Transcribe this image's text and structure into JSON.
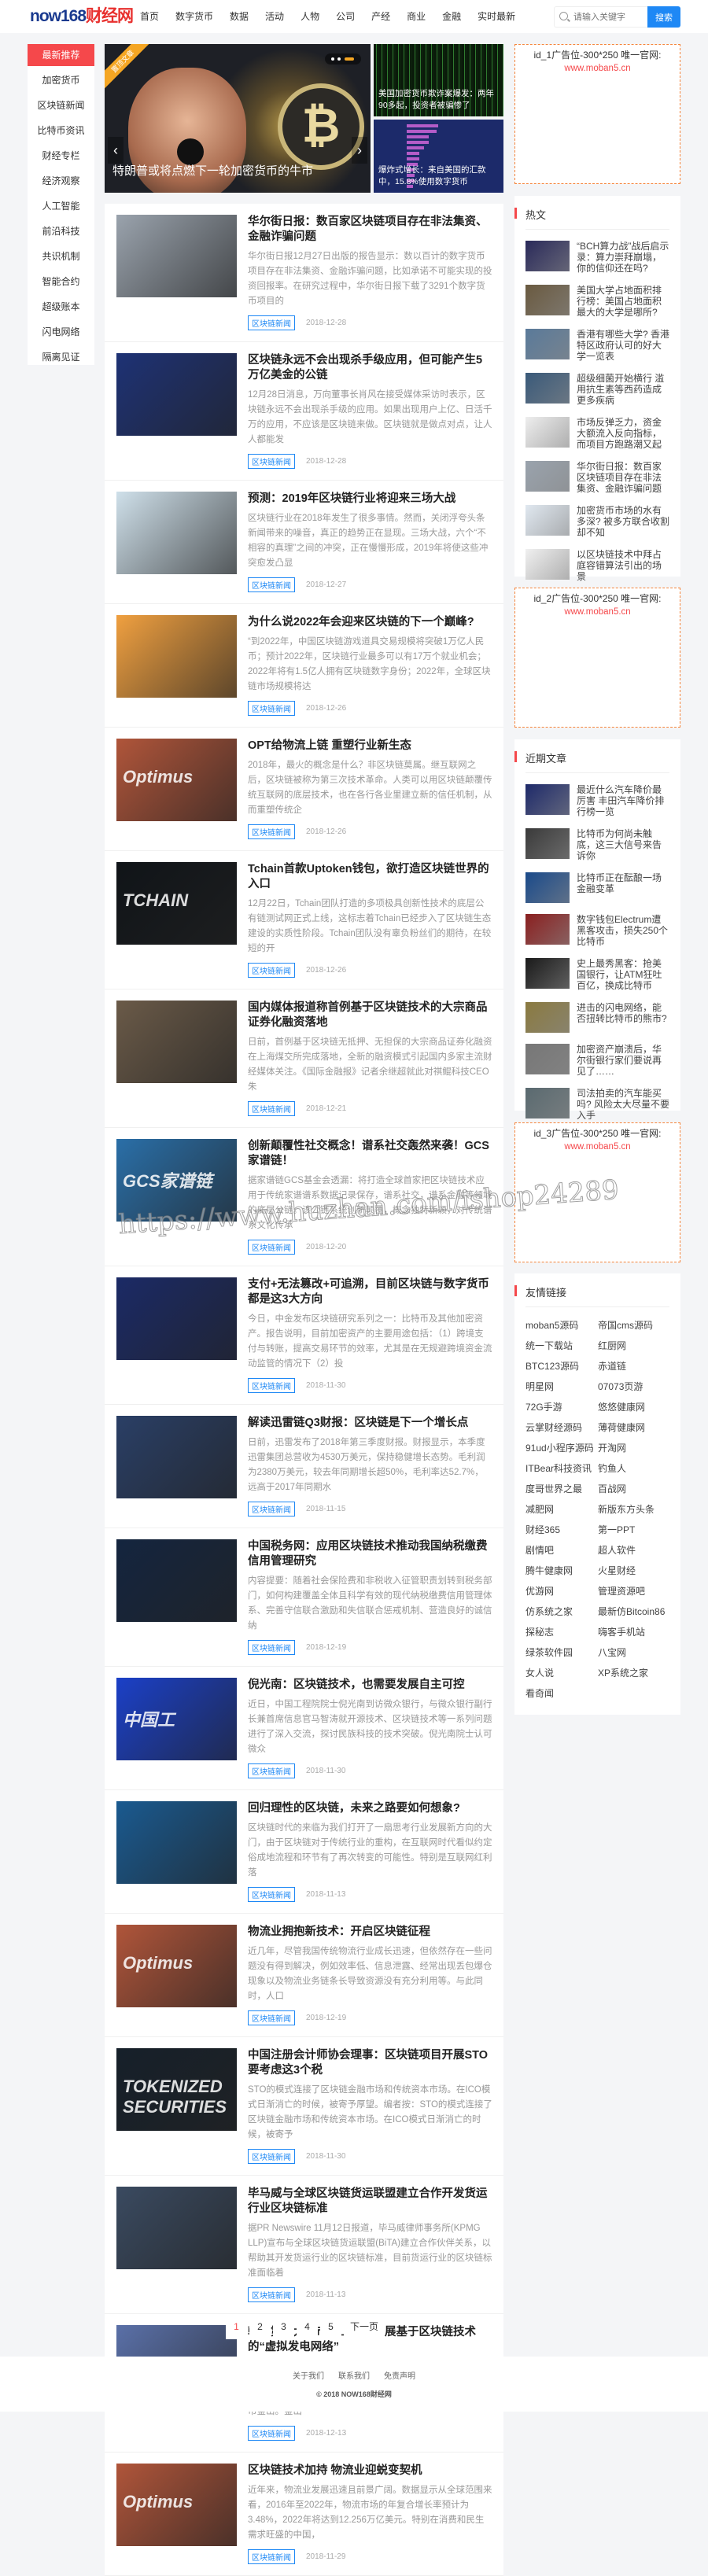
{
  "header": {
    "logo_a": "now168",
    "logo_b": "财经网",
    "nav": [
      "首页",
      "数字货币",
      "数据",
      "活动",
      "人物",
      "公司",
      "产经",
      "商业",
      "金融",
      "实时最新"
    ],
    "search_placeholder": "请输入关键字",
    "search_button": "搜索"
  },
  "leftnav": [
    "最新推荐",
    "加密货币",
    "区块链新闻",
    "比特币资讯",
    "财经专栏",
    "经济观察",
    "人工智能",
    "前沿科技",
    "共识机制",
    "智能合约",
    "超级账本",
    "闪电网络",
    "隔离见证"
  ],
  "slider": {
    "ribbon": "置顶文章",
    "caption": "特朗普或将点燃下一轮加密货币的牛市",
    "prev": "‹",
    "next": "›",
    "coin": "₿",
    "side": [
      "美国加密货币欺诈案爆发：两年90多起，投资者被骗惨了",
      "爆炸式增长：来自美国的汇款中，15.8%使用数字货币"
    ]
  },
  "ads": [
    {
      "title": "id_1广告位-300*250 唯一官网:",
      "url": "www.moban5.cn"
    },
    {
      "title": "id_2广告位-300*250 唯一官网:",
      "url": "www.moban5.cn"
    },
    {
      "title": "id_3广告位-300*250 唯一官网:",
      "url": "www.moban5.cn"
    }
  ],
  "articles": [
    {
      "title": "华尔街日报：数百家区块链项目存在非法集资、金融诈骗问题",
      "excerpt": "华尔街日报12月27日出版的报告显示：数以百计的数字货币项目存在非法集资、金融诈骗问题，比如承诺不可能实现的投资回报率。在研究过程中，华尔街日报下载了3291个数字货币项目的",
      "tag": "区块链新闻",
      "date": "2018-12-28",
      "color": "#9aa3ad"
    },
    {
      "title": "区块链永远不会出现杀手级应用，但可能产生5万亿美金的公链",
      "excerpt": "12月28日消息，万向董事长肖风在接受媒体采访时表示，区块链永远不会出现杀手级的应用。如果出现用户上亿、日活千万的应用，不应该是区块链来做。区块链就是做点对点，让人人都能发",
      "tag": "区块链新闻",
      "date": "2018-12-28",
      "color": "#1e3275"
    },
    {
      "title": "预测：2019年区块链行业将迎来三场大战",
      "excerpt": "区块链行业在2018年发生了很多事情。然而，关闭浮夸头条新闻带来的噪音，真正的趋势正在显现。三场大战，六个“不相容的真理”之间的冲突，正在慢慢形成，2019年将使这些冲突愈发凸显",
      "tag": "区块链新闻",
      "date": "2018-12-27",
      "color": "#cfe0ea"
    },
    {
      "title": "为什么说2022年会迎来区块链的下一个巅峰?",
      "excerpt": "“到2022年，中国区块链游戏道具交易规模将突破1万亿人民币；预计2022年，区块链行业最多可以有17万个就业机会；2022年将有1.5亿人拥有区块链数字身份；2022年，全球区块链市场规模将达",
      "tag": "区块链新闻",
      "date": "2018-12-26",
      "color": "#f0a040"
    },
    {
      "title": "OPT给物流上链 重塑行业新生态",
      "excerpt": "2018年，最火的概念是什么？非区块链莫属。继互联网之后，区块链被称为第三次技术革命。人类可以用区块链颠覆传统互联网的底层技术，也在各行各业里建立新的信任机制，从而重塑传统企",
      "tag": "区块链新闻",
      "date": "2018-12-26",
      "color": "#b0553a",
      "overlay": "Optimus"
    },
    {
      "title": "Tchain首款Uptoken钱包，欲打造区块链世界的入口",
      "excerpt": "12月22日，Tchain团队打造的多项极具创新性技术的底层公有链测试网正式上线，这标志着Tchain已经步入了区块链生态建设的实质性阶段。Tchain团队没有辜负粉丝们的期待，在较短的开",
      "tag": "区块链新闻",
      "date": "2018-12-26",
      "color": "#101418",
      "overlay": "TCHAIN"
    },
    {
      "title": "国内媒体报道称首例基于区块链技术的大宗商品证券化融资落地",
      "excerpt": "日前，首例基于区块链无抵押、无担保的大宗商品证券化融资在上海煤交所完成落地，全新的融资模式引起国内多家主流财经媒体关注。《国际金融报》记者余继超就此对祺鲲科技CEO朱",
      "tag": "区块链新闻",
      "date": "2018-12-21",
      "color": "#6a5a48"
    },
    {
      "title": "创新颠覆性社交概念！谱系社交轰然来袭！GCS家谱链！",
      "excerpt": "据家谱链GCS基金会透漏：将打造全球首家把区块链技术应用于传统家谱谱系数据记录保存，谱系社交，谱系金融等领域的底层公链。该公链系统创新颠覆，概念独特新颖，对传统谱系文化传承",
      "tag": "区块链新闻",
      "date": "2018-12-20",
      "color": "#2a6fa8",
      "overlay": "GCS家谱链"
    },
    {
      "title": "支付+无法篡改+可追溯，目前区块链与数字货币都是这3大方向",
      "excerpt": "今日，中金发布区块链研究系列之一：比特币及其他加密资产。报告说明，目前加密资产的主要用途包括：（1）跨境支付与转账，提高交易环节的效率，尤其是在无规避跨境资金流动监管的情况下（2）投",
      "tag": "区块链新闻",
      "date": "2018-11-30",
      "color": "#1b2a66"
    },
    {
      "title": "解读迅雷链Q3财报：区块链是下一个增长点",
      "excerpt": "日前，迅雷发布了2018年第三季度财报。财报显示，本季度迅雷集团总营收为4530万美元，保持稳健增长态势。毛利润为2380万美元，较去年同期增长超50%，毛利率达52.7%，远高于2017年同期水",
      "tag": "区块链新闻",
      "date": "2018-11-15",
      "color": "#2a3f66"
    },
    {
      "title": "中国税务网：应用区块链技术推动我国纳税缴费信用管理研究",
      "excerpt": "内容提要：随着社会保险费和非税收入征管职责划转到税务部门，如何构建覆盖全体且科学有效的现代纳税缴费信用管理体系、完善守信联合激励和失信联合惩戒机制、营造良好的诚信纳",
      "tag": "区块链新闻",
      "date": "2018-12-19",
      "color": "#14253f"
    },
    {
      "title": "倪光南：区块链技术，也需要发展自主可控",
      "excerpt": "近日，中国工程院院士倪光南到访微众银行，与微众银行副行长兼首席信息官马智涛就开源技术、区块链技术等一系列问题进行了深入交流，探讨民族科技的技术突破。倪光南院士认可微众",
      "tag": "区块链新闻",
      "date": "2018-11-30",
      "color": "#1b40c8",
      "overlay": "中国工"
    },
    {
      "title": "回归理性的区块链，未来之路要如何想象?",
      "excerpt": "区块链时代的来临为我们打开了一扇思考行业发展新方向的大门，由于区块链对于传统行业的重构，在互联网时代看似约定俗成地流程和环节有了再次转变的可能性。特别是互联网红利落",
      "tag": "区块链新闻",
      "date": "2018-11-13",
      "color": "#1a5a90"
    },
    {
      "title": "物流业拥抱新技术：开启区块链征程",
      "excerpt": "近几年，尽管我国传统物流行业成长迅速，但依然存在一些问题没有得到解决，例如效率低、信息泄露、经常出现丢包爆仓现象以及物流业务链条长导致资源没有充分利用等。与此同时，人口",
      "tag": "区块链新闻",
      "date": "2018-12-19",
      "color": "#b0553a",
      "overlay": "Optimus"
    },
    {
      "title": "中国注册会计师协会理事：区块链项目开展STO要考虑这3个税",
      "excerpt": "STO的模式连接了区块链金融市场和传统资本市场。在ICO模式日渐消亡的时候，被寄予厚望。编者按：STO的模式连接了区块链金融市场和传统资本市场。在ICO模式日渐消亡的时候，被寄予",
      "tag": "区块链新闻",
      "date": "2018-11-30",
      "color": "#16202a",
      "overlay": "TOKENIZED SECURITIES"
    },
    {
      "title": "毕马威与全球区块链货运联盟建立合作开发货运行业区块链标准",
      "excerpt": "据PR Newswire 11月12日报道，毕马威律师事务所(KPMG LLP)宣布与全球区块链货运联盟(BiTA)建立合作伙伴关系，以帮助其开发货运行业的区块链标准，目前货运行业的区块链标准面临着",
      "tag": "区块链新闻",
      "date": "2018-11-13",
      "color": "#3a4a60"
    },
    {
      "title": "韩国第二大城市釜山决定发展基于区块链技术的“虚拟发电网络”",
      "excerpt": "2018年12月10日，据当地媒体 Yonhap News 报道，韩国政府决定斥资40亿韩元（355万美金）创建和部署基于区块链技术的“虚拟发网络”，据报道，提出这个计划的是韩国第二大城市釜山。釜山",
      "tag": "区块链新闻",
      "date": "2018-12-13",
      "color": "#5a70a8"
    },
    {
      "title": "区块链技术加持 物流业迎蜕变契机",
      "excerpt": "近年来，物流业发展迅速且前景广阔。数据显示从全球范围来看，2016年至2022年，物流市场的年复合增长率预计为3.48%，2022年将达到12.256万亿美元。特别在消费和民生需求旺盛的中国，",
      "tag": "区块链新闻",
      "date": "2018-11-29",
      "color": "#b0553a",
      "overlay": "Optimus"
    }
  ],
  "hot": {
    "title": "热文",
    "items": [
      {
        "text": "“BCH算力战”战后启示录：算力崇拜崩塌，你的信仰还在吗?",
        "color": "#2a2a5a"
      },
      {
        "text": "美国大学占地面积排行榜：美国占地面积最大的大学是哪所?",
        "color": "#6a5a40"
      },
      {
        "text": "香港有哪些大学? 香港特区政府认可的好大学一览表",
        "color": "#5a7a9a"
      },
      {
        "text": "超级细菌开始横行 滥用抗生素等西药造成更多疾病",
        "color": "#3a5a7a"
      },
      {
        "text": "市场反弹乏力，资金大额流入反向指标，而项目方跑路潮又起",
        "color": "#eeeeee"
      },
      {
        "text": "华尔街日报：数百家区块链项目存在非法集资、金融诈骗问题",
        "color": "#9aa3ad"
      },
      {
        "text": "加密货币市场的水有多深? 被多方联合收割却不知",
        "color": "#e0e8f0"
      },
      {
        "text": "以区块链技术中拜占庭容错算法引出的场景",
        "color": "#f0f0f0"
      }
    ]
  },
  "recent": {
    "title": "近期文章",
    "items": [
      {
        "text": "最近什么汽车降价最厉害 丰田汽车降价排行榜一览",
        "color": "#1e2a6a"
      },
      {
        "text": "比特币为何尚未触底，这三大信号来告诉你",
        "color": "#3a3a3a"
      },
      {
        "text": "比特币正在酝酿一场金融变革",
        "color": "#1a4a8a"
      },
      {
        "text": "数字钱包Electrum遭黑客攻击，损失250个比特币",
        "color": "#8a2020"
      },
      {
        "text": "史上最秀黑客：抢美国银行，让ATM狂吐百亿，换成比特币",
        "color": "#1a1a1a"
      },
      {
        "text": "进击的闪电网络，能否扭转比特币的熊市?",
        "color": "#8a7a40"
      },
      {
        "text": "加密资产崩溃后，华尔街银行家们要说再见了……",
        "color": "#777777"
      },
      {
        "text": "司法拍卖的汽车能买吗? 风险太大尽量不要入手",
        "color": "#5a6a70"
      }
    ]
  },
  "friends": {
    "title": "友情链接",
    "items": [
      "moban5源码",
      "帝国cms源码",
      "统一下载站",
      "红厨网",
      "BTC123源码",
      "赤道链",
      "明星网",
      "07073页游",
      "72G手游",
      "悠悠健康网",
      "云掌财经源码",
      "薄荷健康网",
      "91ud小程序源码",
      "开淘网",
      "ITBear科技资讯",
      "钓鱼人",
      "度哥世界之最",
      "百战网",
      "减肥网",
      "新版东方头条",
      "财经365",
      "第一PPT",
      "剧情吧",
      "超人软件",
      "腾牛健康网",
      "火星财经",
      "优游网",
      "管理资源吧",
      "仿系统之家",
      "最新仿Bitcoin86",
      "探秘志",
      "嗨客手机站",
      "绿茶软件园",
      "八宝网",
      "女人说",
      "XP系统之家",
      "看奇闻"
    ]
  },
  "pager": {
    "pages": [
      "1",
      "2",
      "3",
      "4",
      "5"
    ],
    "next": "下一页",
    "current": "1"
  },
  "footer": {
    "links": [
      "关于我们",
      "联系我们",
      "免责声明"
    ],
    "copyright": "© 2018 NOW168财经网"
  },
  "watermark": "https://www.huzhan.com/ishop24289",
  "colors": {
    "accent": "#f5484b",
    "link": "#1e88f5",
    "ad_border": "#f5843a"
  }
}
